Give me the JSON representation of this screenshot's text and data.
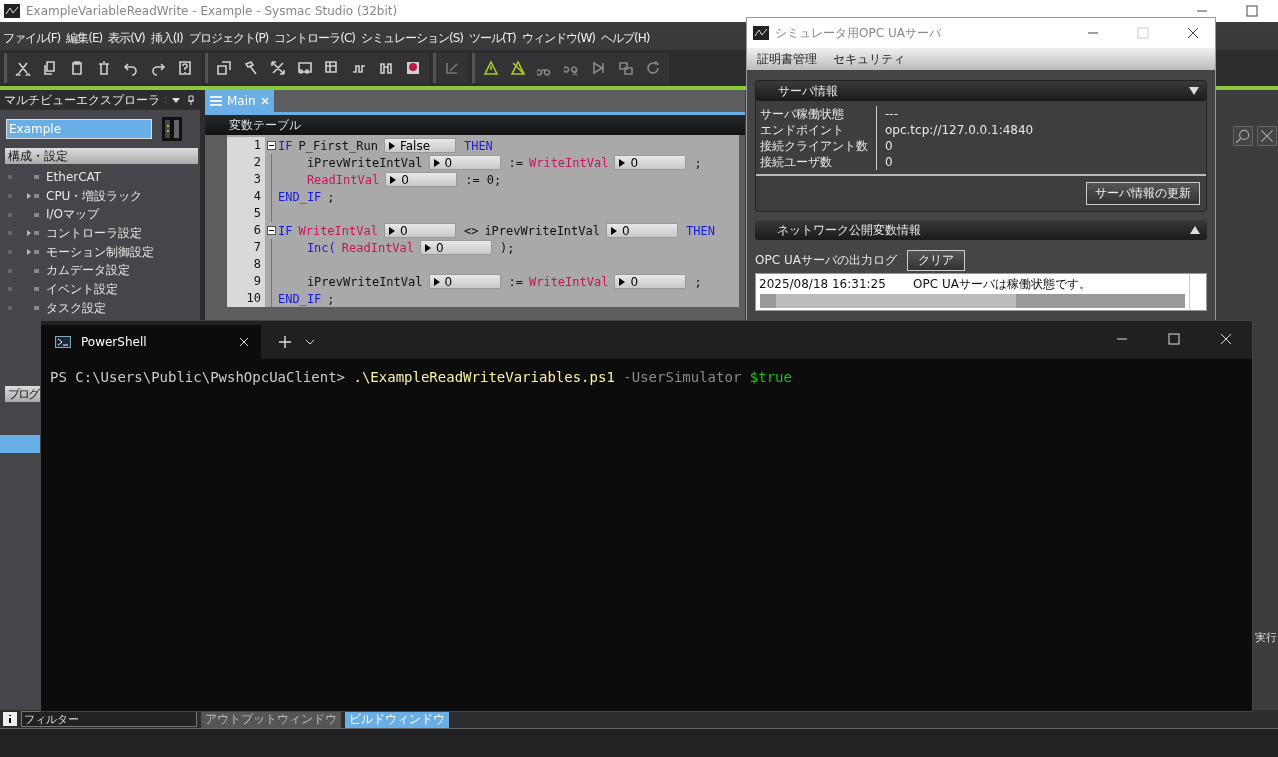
{
  "main_window": {
    "title": "ExampleVariableReadWrite - Example - Sysmac Studio (32bit)",
    "menu": [
      "ファイル(F)",
      "編集(E)",
      "表示(V)",
      "挿入(I)",
      "プロジェクト(P)",
      "コントローラ(C)",
      "シミュレーション(S)",
      "ツール(T)",
      "ウィンドウ(W)",
      "ヘルプ(H)"
    ]
  },
  "explorer": {
    "title": "マルチビューエクスプローラ",
    "device": "Example",
    "section": "構成・設定",
    "items": [
      {
        "label": "EtherCAT",
        "expandable": false
      },
      {
        "label": "CPU・増設ラック",
        "expandable": true
      },
      {
        "label": "I/Oマップ",
        "expandable": false
      },
      {
        "label": "コントローラ設定",
        "expandable": true
      },
      {
        "label": "モーション制御設定",
        "expandable": true
      },
      {
        "label": "カムデータ設定",
        "expandable": false
      },
      {
        "label": "イベント設定",
        "expandable": false
      },
      {
        "label": "タスク設定",
        "expandable": false
      }
    ],
    "section_2": "プログ"
  },
  "editor": {
    "tabs": [
      {
        "label": "Main",
        "selected": true
      }
    ],
    "header": "変数テーブル",
    "lines": [
      {
        "number": "1",
        "fold": true,
        "tokens": [
          {
            "kind": "keyword",
            "text": "IF"
          },
          {
            "kind": "name",
            "text": "P_First_Run"
          },
          {
            "kind": "value",
            "text": "False"
          },
          {
            "kind": "keyword",
            "text": "THEN"
          }
        ]
      },
      {
        "number": "2",
        "fold": false,
        "tokens": [
          {
            "kind": "name",
            "text": "    iPrevWriteIntVal"
          },
          {
            "kind": "value",
            "text": "0"
          },
          {
            "kind": "op",
            "text": ":="
          },
          {
            "kind": "global",
            "text": "WriteIntVal"
          },
          {
            "kind": "value",
            "text": "0"
          },
          {
            "kind": "op",
            "text": ";"
          }
        ]
      },
      {
        "number": "3",
        "fold": false,
        "tokens": [
          {
            "kind": "global",
            "text": "    ReadIntVal"
          },
          {
            "kind": "value",
            "text": "0"
          },
          {
            "kind": "op",
            "text": ":= 0;"
          }
        ]
      },
      {
        "number": "4",
        "fold": false,
        "tokens": [
          {
            "kind": "keyword",
            "text": "END_IF"
          },
          {
            "kind": "op",
            "text": ";"
          }
        ]
      },
      {
        "number": "5",
        "fold": false
      },
      {
        "number": "6",
        "fold": true,
        "tokens": [
          {
            "kind": "keyword",
            "text": "IF"
          },
          {
            "kind": "global",
            "text": "WriteIntVal"
          },
          {
            "kind": "value",
            "text": "0"
          },
          {
            "kind": "op",
            "text": "<>"
          },
          {
            "kind": "name",
            "text": "iPrevWriteIntVal"
          },
          {
            "kind": "value",
            "text": "0"
          },
          {
            "kind": "keyword",
            "text": "THEN"
          }
        ]
      },
      {
        "number": "7",
        "fold": false,
        "tokens": [
          {
            "kind": "keyword",
            "text": "    Inc("
          },
          {
            "kind": "global",
            "text": "ReadIntVal"
          },
          {
            "kind": "value",
            "text": "0"
          },
          {
            "kind": "op",
            "text": ");"
          }
        ]
      },
      {
        "number": "8",
        "fold": false
      },
      {
        "number": "9",
        "fold": false,
        "tokens": [
          {
            "kind": "name",
            "text": "    iPrevWriteIntVal"
          },
          {
            "kind": "value",
            "text": "0"
          },
          {
            "kind": "op",
            "text": ":="
          },
          {
            "kind": "global",
            "text": "WriteIntVal"
          },
          {
            "kind": "value",
            "text": "0"
          },
          {
            "kind": "op",
            "text": ";"
          }
        ]
      },
      {
        "number": "10",
        "fold": false,
        "tokens": [
          {
            "kind": "keyword",
            "text": "END_IF"
          },
          {
            "kind": "op",
            "text": ";"
          }
        ]
      }
    ]
  },
  "right_panel": {
    "text": "実行"
  },
  "opc_window": {
    "title": "シミュレータ用OPC UAサーバ",
    "menu": [
      "証明書管理",
      "セキュリティ"
    ],
    "server_info": {
      "title": "サーバ情報",
      "expanded": true,
      "rows": [
        {
          "label": "サーバ稼働状態",
          "value": "---"
        },
        {
          "label": "エンドポイント",
          "value": "opc.tcp://127.0.0.1:4840"
        },
        {
          "label": "接続クライアント数",
          "value": "0"
        },
        {
          "label": "接続ユーザ数",
          "value": "0"
        }
      ],
      "button": "サーバ情報の更新"
    },
    "network_section": {
      "title": "ネットワーク公開変数情報",
      "expanded": false
    },
    "log_label": "OPC UAサーバの出力ログ",
    "clear_button": "クリア",
    "log": [
      {
        "time": "2025/08/18 16:31:25",
        "message": "OPC UAサーバは稼働状態です。"
      }
    ]
  },
  "powershell": {
    "tabs": [
      {
        "label": "PowerShell",
        "selected": true
      }
    ],
    "prompt": "PS C:\\Users\\Public\\PwshOpcUaClient>",
    "command": ".\\ExampleReadWriteVariables.ps1",
    "parameter": "-UserSimulator",
    "argument": "$true"
  },
  "bottom": {
    "filter_placeholder": "フィルター",
    "tabs": [
      {
        "label": "アウトプットウィンドウ",
        "selected": false
      },
      {
        "label": "ビルドウィンドウ",
        "selected": true
      }
    ]
  }
}
